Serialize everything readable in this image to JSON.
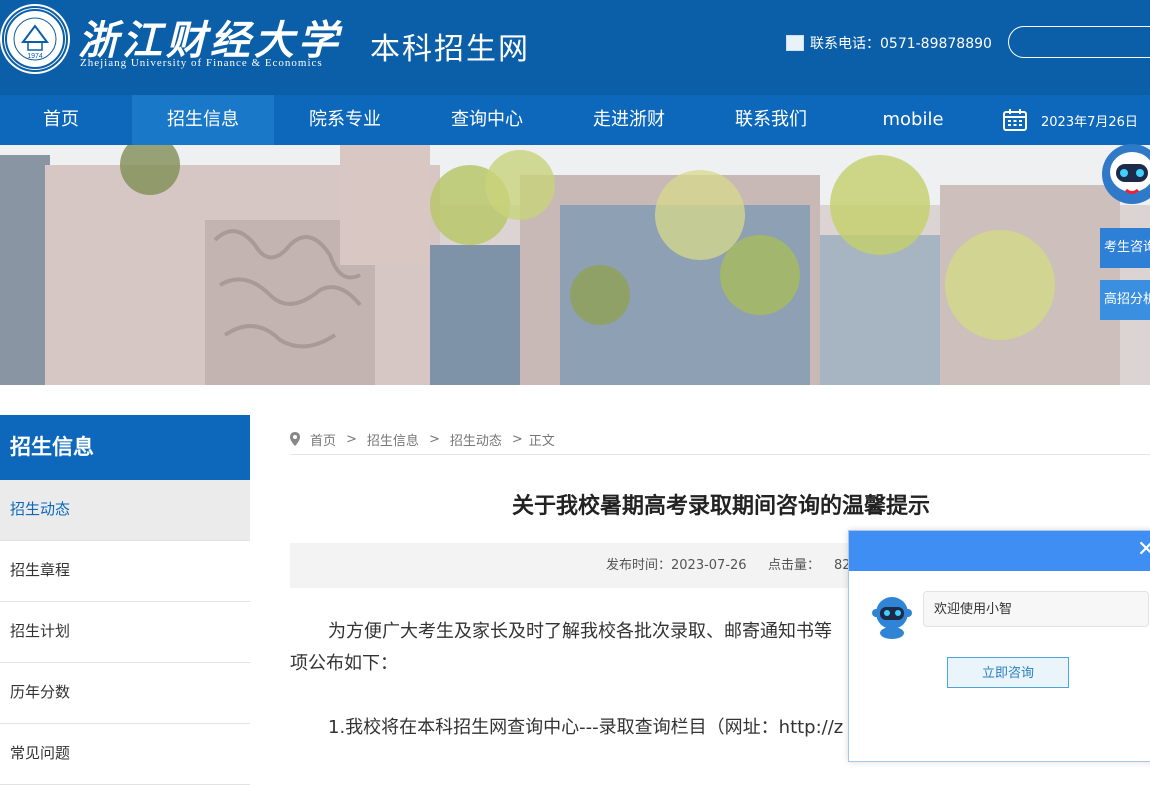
{
  "header": {
    "university_cn": "浙江财经大学",
    "university_en": "Zhejiang University of Finance & Economics",
    "seal_year": "1974",
    "site_name": "本科招生网",
    "phone_label": "联系电话：0571-89878890"
  },
  "nav": {
    "items": [
      {
        "label": "首页"
      },
      {
        "label": "招生信息"
      },
      {
        "label": "院系专业"
      },
      {
        "label": "查询中心"
      },
      {
        "label": "走进浙财"
      },
      {
        "label": "联系我们"
      },
      {
        "label": "mobile"
      }
    ],
    "active_index": 1,
    "date": "2023年7月26日"
  },
  "sidebar": {
    "title": "招生信息",
    "items": [
      {
        "label": "招生动态"
      },
      {
        "label": "招生章程"
      },
      {
        "label": "招生计划"
      },
      {
        "label": "历年分数"
      },
      {
        "label": "常见问题"
      }
    ],
    "active_index": 0
  },
  "breadcrumb": {
    "home": "首页",
    "level1": "招生信息",
    "level2": "招生动态",
    "current": "正文",
    "sep": ">"
  },
  "article": {
    "title": "关于我校暑期高考录取期间咨询的温馨提示",
    "publish_label": "发布时间：2023-07-26",
    "hits_label": "点击量：",
    "hits_value": "82",
    "para1_line1": "为方便广大考生及家长及时了解我校各批次录取、邮寄通知书等",
    "para1_line2": "项公布如下：",
    "para2": "1.我校将在本科招生网查询中心---录取查询栏目（网址：http://z"
  },
  "float_panel": {
    "btn1": "考生咨询",
    "btn2": "高招分析"
  },
  "chat": {
    "close": "✕",
    "welcome": "欢迎使用小智",
    "consult_button": "立即咨询"
  },
  "colors": {
    "header_bg": "#0b5ea8",
    "nav_bg": "#0d68bb",
    "accent": "#3f8ef4"
  },
  "icons": [
    "phone-icon",
    "calendar-icon",
    "location-pin-icon",
    "close-icon",
    "robot-icon"
  ]
}
